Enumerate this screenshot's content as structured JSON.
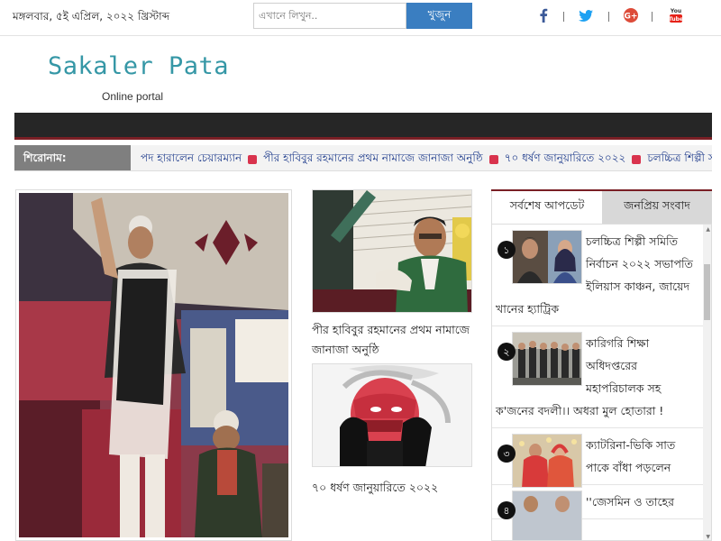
{
  "header": {
    "date": "মঙ্গলবার, ৫ই এপ্রিল, ২০২২ খ্রিস্টাব্দ",
    "search_placeholder": "এখানে লিখুন..",
    "search_button": "খুজুন",
    "social_icons": [
      "facebook-icon",
      "twitter-icon",
      "google-plus-icon",
      "youtube-icon"
    ],
    "social_colors": {
      "facebook": "#3b5998",
      "twitter": "#1da1f2",
      "google": "#dd4b39",
      "youtube": "#e62117"
    }
  },
  "logo": {
    "name": "Sakaler Pata",
    "tagline": "Online portal",
    "color": "#3597a6"
  },
  "ticker": {
    "label": "শিরোনাম:",
    "items": [
      "পদ হারালেন চেয়ারম্যান",
      "পীর হাবিবুর রহমানের প্রথম নামাজে জানাজা অনুষ্ঠি",
      "৭০ ধর্ষণ জানুয়ারিতে ২০২২",
      "চলচ্চিত্র শিল্পী সমিতি নির্বাচন"
    ]
  },
  "middle_stories": [
    {
      "title": "পীর হাবিবুর রহমানের প্রথম নামাজে জানাজা অনুষ্ঠি"
    },
    {
      "title": "৭০ ধর্ষণ জানুয়ারিতে ২০২২"
    }
  ],
  "tabs": {
    "latest": "সর্বশেষ আপডেট",
    "popular": "জনপ্রিয় সংবাদ"
  },
  "latest_list": [
    {
      "num": "১",
      "title": "চলচ্চিত্র শিল্পী সমিতি নির্বাচন ২০২২ সভাপতি ইলিয়াস কাঞ্চন, জায়েদ খানের হ্যাট্রিক"
    },
    {
      "num": "২",
      "title": "কারিগরি শিক্ষা অধিদপ্তরের মহাপরিচালক সহ ক'জনের বদলী।। অধরা মুল হোতারা !"
    },
    {
      "num": "৩",
      "title": "ক্যাটরিনা-ভিকি সাত পাকে বাঁধা পড়লেন"
    },
    {
      "num": "৪",
      "title": "''জেসমিন ও তাহের"
    }
  ]
}
